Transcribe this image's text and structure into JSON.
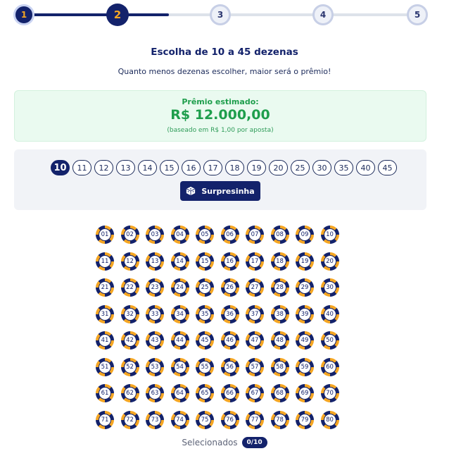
{
  "stepper": {
    "steps": [
      {
        "label": "1",
        "state": "done"
      },
      {
        "label": "2",
        "state": "current"
      },
      {
        "label": "3",
        "state": "todo"
      },
      {
        "label": "4",
        "state": "todo"
      },
      {
        "label": "5",
        "state": "todo"
      }
    ]
  },
  "header": {
    "title": "Escolha de 10 a 45 dezenas",
    "subtitle": "Quanto menos dezenas escolher, maior será o prêmio!"
  },
  "prize": {
    "label": "Prêmio estimado:",
    "value": "R$ 12.000,00",
    "note": "(baseado em R$ 1,00 por aposta)"
  },
  "quantity": {
    "options": [
      "10",
      "11",
      "12",
      "13",
      "14",
      "15",
      "16",
      "17",
      "18",
      "19",
      "20",
      "25",
      "30",
      "35",
      "40",
      "45"
    ],
    "selected": "10",
    "surprise_label": "Surpresinha"
  },
  "numbers": [
    "01",
    "02",
    "03",
    "04",
    "05",
    "06",
    "07",
    "08",
    "09",
    "10",
    "11",
    "12",
    "13",
    "14",
    "15",
    "16",
    "17",
    "18",
    "19",
    "20",
    "21",
    "22",
    "23",
    "24",
    "25",
    "26",
    "27",
    "28",
    "29",
    "30",
    "31",
    "32",
    "33",
    "34",
    "35",
    "36",
    "37",
    "38",
    "39",
    "40",
    "41",
    "42",
    "43",
    "44",
    "45",
    "46",
    "47",
    "48",
    "49",
    "50",
    "51",
    "52",
    "53",
    "54",
    "55",
    "56",
    "57",
    "58",
    "59",
    "60",
    "61",
    "62",
    "63",
    "64",
    "65",
    "66",
    "67",
    "68",
    "69",
    "70",
    "71",
    "72",
    "73",
    "74",
    "75",
    "76",
    "77",
    "78",
    "79",
    "80"
  ],
  "footer": {
    "selected_label": "Selecionados",
    "selected_count": "0/10"
  },
  "colors": {
    "primary": "#13226b",
    "accent": "#f5a623",
    "success": "#1e9e4c"
  }
}
